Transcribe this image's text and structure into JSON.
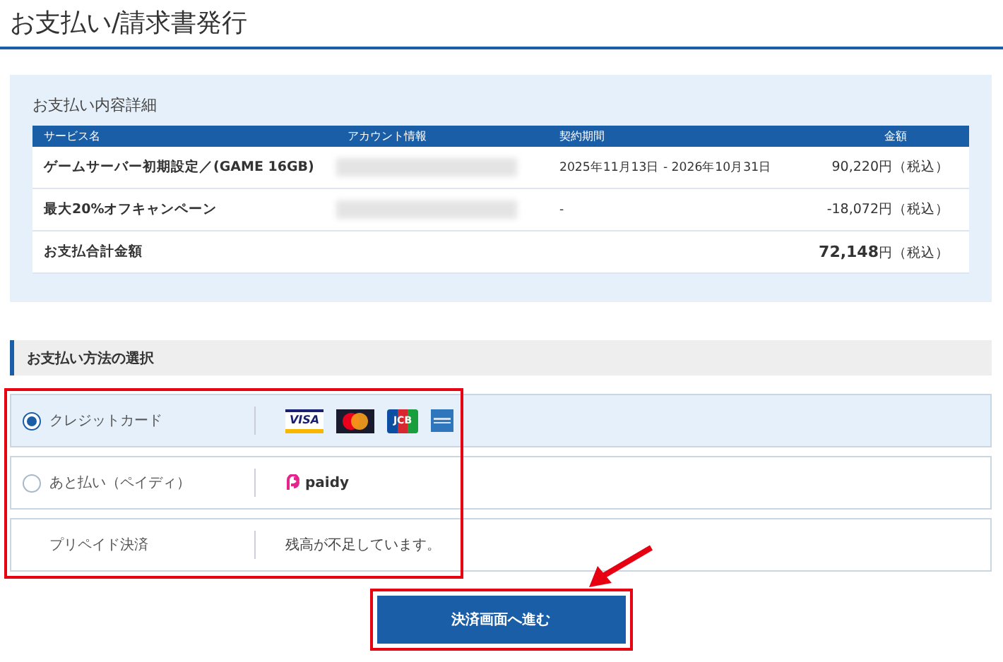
{
  "page_title": "お支払い/請求書発行",
  "details": {
    "heading": "お支払い内容詳細",
    "columns": [
      "サービス名",
      "アカウント情報",
      "契約期間",
      "金額"
    ],
    "rows": [
      {
        "service": "ゲームサーバー初期設定／(GAME 16GB)",
        "account_redacted": true,
        "period": "2025年11月13日 - 2026年10月31日",
        "amount": "90,220円",
        "tax": "（税込）"
      },
      {
        "service": "最大20%オフキャンペーン",
        "account_redacted": true,
        "period": "-",
        "amount": "-18,072円",
        "tax": "（税込）"
      }
    ],
    "total": {
      "label": "お支払合計金額",
      "amount": "72,148",
      "unit": "円",
      "tax": "（税込）"
    }
  },
  "payment": {
    "heading": "お支払い方法の選択",
    "methods": [
      {
        "kind": "radio",
        "label": "クレジットカード",
        "selected": true,
        "logos": [
          {
            "kind": "visa",
            "text": "VISA"
          },
          {
            "kind": "mastercard"
          },
          {
            "kind": "jcb",
            "text": "JCB"
          },
          {
            "kind": "amex"
          }
        ]
      },
      {
        "kind": "radio",
        "label": "あと払い（ペイディ）",
        "selected": false,
        "logos": [
          {
            "kind": "paidy",
            "text": "paidy"
          }
        ]
      },
      {
        "kind": "plain",
        "label": "プリペイド決済",
        "note": "残高が不足しています。"
      }
    ]
  },
  "submit_button": "決済画面へ進む"
}
